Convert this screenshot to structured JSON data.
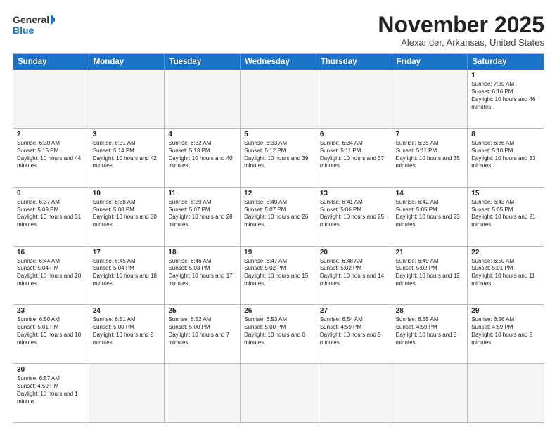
{
  "header": {
    "logo_general": "General",
    "logo_blue": "Blue",
    "month_title": "November 2025",
    "location": "Alexander, Arkansas, United States"
  },
  "days_of_week": [
    "Sunday",
    "Monday",
    "Tuesday",
    "Wednesday",
    "Thursday",
    "Friday",
    "Saturday"
  ],
  "weeks": [
    [
      {
        "day": "",
        "info": ""
      },
      {
        "day": "",
        "info": ""
      },
      {
        "day": "",
        "info": ""
      },
      {
        "day": "",
        "info": ""
      },
      {
        "day": "",
        "info": ""
      },
      {
        "day": "",
        "info": ""
      },
      {
        "day": "1",
        "info": "Sunrise: 7:30 AM\nSunset: 6:16 PM\nDaylight: 10 hours and 46 minutes."
      }
    ],
    [
      {
        "day": "2",
        "info": "Sunrise: 6:30 AM\nSunset: 5:15 PM\nDaylight: 10 hours and 44 minutes."
      },
      {
        "day": "3",
        "info": "Sunrise: 6:31 AM\nSunset: 5:14 PM\nDaylight: 10 hours and 42 minutes."
      },
      {
        "day": "4",
        "info": "Sunrise: 6:32 AM\nSunset: 5:13 PM\nDaylight: 10 hours and 40 minutes."
      },
      {
        "day": "5",
        "info": "Sunrise: 6:33 AM\nSunset: 5:12 PM\nDaylight: 10 hours and 39 minutes."
      },
      {
        "day": "6",
        "info": "Sunrise: 6:34 AM\nSunset: 5:11 PM\nDaylight: 10 hours and 37 minutes."
      },
      {
        "day": "7",
        "info": "Sunrise: 6:35 AM\nSunset: 5:11 PM\nDaylight: 10 hours and 35 minutes."
      },
      {
        "day": "8",
        "info": "Sunrise: 6:36 AM\nSunset: 5:10 PM\nDaylight: 10 hours and 33 minutes."
      }
    ],
    [
      {
        "day": "9",
        "info": "Sunrise: 6:37 AM\nSunset: 5:09 PM\nDaylight: 10 hours and 31 minutes."
      },
      {
        "day": "10",
        "info": "Sunrise: 6:38 AM\nSunset: 5:08 PM\nDaylight: 10 hours and 30 minutes."
      },
      {
        "day": "11",
        "info": "Sunrise: 6:39 AM\nSunset: 5:07 PM\nDaylight: 10 hours and 28 minutes."
      },
      {
        "day": "12",
        "info": "Sunrise: 6:40 AM\nSunset: 5:07 PM\nDaylight: 10 hours and 26 minutes."
      },
      {
        "day": "13",
        "info": "Sunrise: 6:41 AM\nSunset: 5:06 PM\nDaylight: 10 hours and 25 minutes."
      },
      {
        "day": "14",
        "info": "Sunrise: 6:42 AM\nSunset: 5:05 PM\nDaylight: 10 hours and 23 minutes."
      },
      {
        "day": "15",
        "info": "Sunrise: 6:43 AM\nSunset: 5:05 PM\nDaylight: 10 hours and 21 minutes."
      }
    ],
    [
      {
        "day": "16",
        "info": "Sunrise: 6:44 AM\nSunset: 5:04 PM\nDaylight: 10 hours and 20 minutes."
      },
      {
        "day": "17",
        "info": "Sunrise: 6:45 AM\nSunset: 5:04 PM\nDaylight: 10 hours and 18 minutes."
      },
      {
        "day": "18",
        "info": "Sunrise: 6:46 AM\nSunset: 5:03 PM\nDaylight: 10 hours and 17 minutes."
      },
      {
        "day": "19",
        "info": "Sunrise: 6:47 AM\nSunset: 5:02 PM\nDaylight: 10 hours and 15 minutes."
      },
      {
        "day": "20",
        "info": "Sunrise: 6:48 AM\nSunset: 5:02 PM\nDaylight: 10 hours and 14 minutes."
      },
      {
        "day": "21",
        "info": "Sunrise: 6:49 AM\nSunset: 5:02 PM\nDaylight: 10 hours and 12 minutes."
      },
      {
        "day": "22",
        "info": "Sunrise: 6:50 AM\nSunset: 5:01 PM\nDaylight: 10 hours and 11 minutes."
      }
    ],
    [
      {
        "day": "23",
        "info": "Sunrise: 6:50 AM\nSunset: 5:01 PM\nDaylight: 10 hours and 10 minutes."
      },
      {
        "day": "24",
        "info": "Sunrise: 6:51 AM\nSunset: 5:00 PM\nDaylight: 10 hours and 8 minutes."
      },
      {
        "day": "25",
        "info": "Sunrise: 6:52 AM\nSunset: 5:00 PM\nDaylight: 10 hours and 7 minutes."
      },
      {
        "day": "26",
        "info": "Sunrise: 6:53 AM\nSunset: 5:00 PM\nDaylight: 10 hours and 6 minutes."
      },
      {
        "day": "27",
        "info": "Sunrise: 6:54 AM\nSunset: 4:59 PM\nDaylight: 10 hours and 5 minutes."
      },
      {
        "day": "28",
        "info": "Sunrise: 6:55 AM\nSunset: 4:59 PM\nDaylight: 10 hours and 3 minutes."
      },
      {
        "day": "29",
        "info": "Sunrise: 6:56 AM\nSunset: 4:59 PM\nDaylight: 10 hours and 2 minutes."
      }
    ],
    [
      {
        "day": "30",
        "info": "Sunrise: 6:57 AM\nSunset: 4:59 PM\nDaylight: 10 hours and 1 minute."
      },
      {
        "day": "",
        "info": ""
      },
      {
        "day": "",
        "info": ""
      },
      {
        "day": "",
        "info": ""
      },
      {
        "day": "",
        "info": ""
      },
      {
        "day": "",
        "info": ""
      },
      {
        "day": "",
        "info": ""
      }
    ]
  ]
}
